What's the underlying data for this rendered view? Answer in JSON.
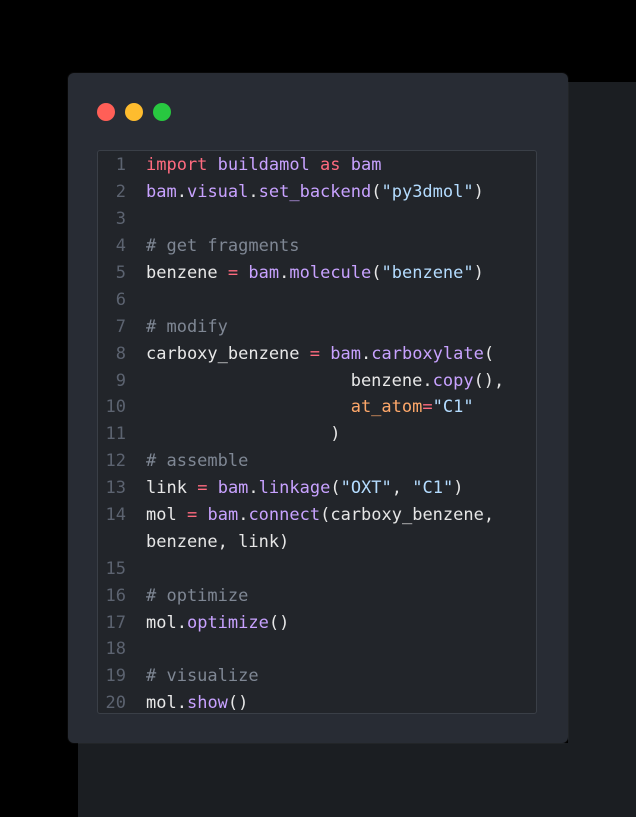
{
  "window": {
    "controls": [
      {
        "name": "close",
        "color": "#ff5f57"
      },
      {
        "name": "minimize",
        "color": "#febc2e"
      },
      {
        "name": "maximize",
        "color": "#28c840"
      }
    ]
  },
  "lines": [
    {
      "num": "1",
      "tokens": [
        {
          "t": "import",
          "k": "keyword"
        },
        {
          "t": " ",
          "k": "punc"
        },
        {
          "t": "buildamol",
          "k": "mod"
        },
        {
          "t": " ",
          "k": "punc"
        },
        {
          "t": "as",
          "k": "keyword"
        },
        {
          "t": " ",
          "k": "punc"
        },
        {
          "t": "bam",
          "k": "mod"
        }
      ]
    },
    {
      "num": "2",
      "tokens": [
        {
          "t": "bam",
          "k": "mod"
        },
        {
          "t": ".",
          "k": "punc"
        },
        {
          "t": "visual",
          "k": "fn"
        },
        {
          "t": ".",
          "k": "punc"
        },
        {
          "t": "set_backend",
          "k": "fn"
        },
        {
          "t": "(",
          "k": "punc"
        },
        {
          "t": "\"py3dmol\"",
          "k": "str"
        },
        {
          "t": ")",
          "k": "punc"
        }
      ]
    },
    {
      "num": "3",
      "tokens": []
    },
    {
      "num": "4",
      "tokens": [
        {
          "t": "# get fragments",
          "k": "comment"
        }
      ]
    },
    {
      "num": "5",
      "tokens": [
        {
          "t": "benzene",
          "k": "id"
        },
        {
          "t": " ",
          "k": "punc"
        },
        {
          "t": "=",
          "k": "op"
        },
        {
          "t": " ",
          "k": "punc"
        },
        {
          "t": "bam",
          "k": "mod"
        },
        {
          "t": ".",
          "k": "punc"
        },
        {
          "t": "molecule",
          "k": "fn"
        },
        {
          "t": "(",
          "k": "punc"
        },
        {
          "t": "\"benzene\"",
          "k": "str"
        },
        {
          "t": ")",
          "k": "punc"
        }
      ]
    },
    {
      "num": "6",
      "tokens": []
    },
    {
      "num": "7",
      "tokens": [
        {
          "t": "# modify",
          "k": "comment"
        }
      ]
    },
    {
      "num": "8",
      "tokens": [
        {
          "t": "carboxy_benzene",
          "k": "id"
        },
        {
          "t": " ",
          "k": "punc"
        },
        {
          "t": "=",
          "k": "op"
        },
        {
          "t": " ",
          "k": "punc"
        },
        {
          "t": "bam",
          "k": "mod"
        },
        {
          "t": ".",
          "k": "punc"
        },
        {
          "t": "carboxylate",
          "k": "fn"
        },
        {
          "t": "(",
          "k": "punc"
        }
      ]
    },
    {
      "num": "9",
      "tokens": [
        {
          "t": "                    ",
          "k": "punc"
        },
        {
          "t": "benzene",
          "k": "id"
        },
        {
          "t": ".",
          "k": "punc"
        },
        {
          "t": "copy",
          "k": "fn"
        },
        {
          "t": "(),",
          "k": "punc"
        }
      ]
    },
    {
      "num": "10",
      "tokens": [
        {
          "t": "                    ",
          "k": "punc"
        },
        {
          "t": "at_atom",
          "k": "param"
        },
        {
          "t": "=",
          "k": "op"
        },
        {
          "t": "\"C1\"",
          "k": "str"
        }
      ]
    },
    {
      "num": "11",
      "tokens": [
        {
          "t": "                  ",
          "k": "punc"
        },
        {
          "t": ")",
          "k": "punc"
        }
      ]
    },
    {
      "num": "12",
      "tokens": [
        {
          "t": "# assemble",
          "k": "comment"
        }
      ]
    },
    {
      "num": "13",
      "tokens": [
        {
          "t": "link",
          "k": "id"
        },
        {
          "t": " ",
          "k": "punc"
        },
        {
          "t": "=",
          "k": "op"
        },
        {
          "t": " ",
          "k": "punc"
        },
        {
          "t": "bam",
          "k": "mod"
        },
        {
          "t": ".",
          "k": "punc"
        },
        {
          "t": "linkage",
          "k": "fn"
        },
        {
          "t": "(",
          "k": "punc"
        },
        {
          "t": "\"OXT\"",
          "k": "str"
        },
        {
          "t": ", ",
          "k": "punc"
        },
        {
          "t": "\"C1\"",
          "k": "str"
        },
        {
          "t": ")",
          "k": "punc"
        }
      ]
    },
    {
      "num": "14",
      "tokens": [
        {
          "t": "mol",
          "k": "id"
        },
        {
          "t": " ",
          "k": "punc"
        },
        {
          "t": "=",
          "k": "op"
        },
        {
          "t": " ",
          "k": "punc"
        },
        {
          "t": "bam",
          "k": "mod"
        },
        {
          "t": ".",
          "k": "punc"
        },
        {
          "t": "connect",
          "k": "fn"
        },
        {
          "t": "(carboxy_benzene,",
          "k": "punc"
        }
      ]
    },
    {
      "num": "",
      "tokens": [
        {
          "t": "benzene, link)",
          "k": "punc"
        }
      ]
    },
    {
      "num": "15",
      "tokens": []
    },
    {
      "num": "16",
      "tokens": [
        {
          "t": "# optimize",
          "k": "comment"
        }
      ]
    },
    {
      "num": "17",
      "tokens": [
        {
          "t": "mol",
          "k": "id"
        },
        {
          "t": ".",
          "k": "punc"
        },
        {
          "t": "optimize",
          "k": "fn"
        },
        {
          "t": "()",
          "k": "punc"
        }
      ]
    },
    {
      "num": "18",
      "tokens": []
    },
    {
      "num": "19",
      "tokens": [
        {
          "t": "# visualize",
          "k": "comment"
        }
      ]
    },
    {
      "num": "20",
      "tokens": [
        {
          "t": "mol",
          "k": "id"
        },
        {
          "t": ".",
          "k": "punc"
        },
        {
          "t": "show",
          "k": "fn"
        },
        {
          "t": "()",
          "k": "punc"
        }
      ]
    }
  ]
}
